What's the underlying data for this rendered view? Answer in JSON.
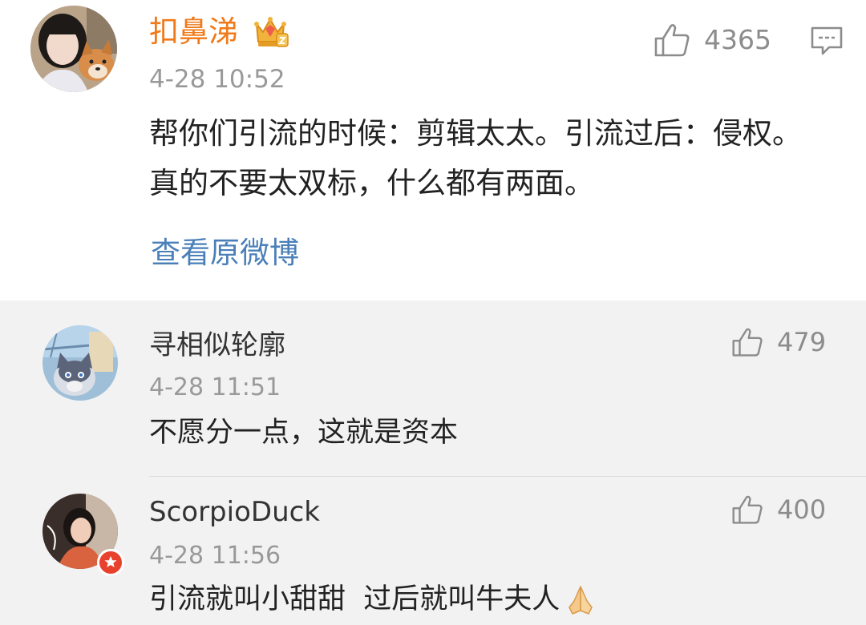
{
  "main_comment": {
    "username": "扣鼻涕",
    "timestamp": "4-28 10:52",
    "likes": "4365",
    "text": "帮你们引流的时候：剪辑太太。引流过后：侵权。真的不要太双标，什么都有两面。",
    "view_original_label": "查看原微博",
    "icons": {
      "badge": "crown-icon",
      "like": "thumbs-up-icon",
      "reply": "comment-icon"
    }
  },
  "replies": [
    {
      "username": "寻相似轮廓",
      "timestamp": "4-28 11:51",
      "likes": "479",
      "text": "不愿分一点，这就是资本"
    },
    {
      "username": "ScorpioDuck",
      "timestamp": "4-28 11:56",
      "likes": "400",
      "text": "引流就叫小甜甜  过后就叫牛夫人",
      "emoji": "pray-hands-emoji"
    }
  ],
  "colors": {
    "username_vip": "#f07a1a",
    "link": "#4a7fb8",
    "meta": "#999999",
    "body_text": "#222222",
    "reply_background": "#f2f2f2",
    "badge_red": "#e8412d"
  }
}
